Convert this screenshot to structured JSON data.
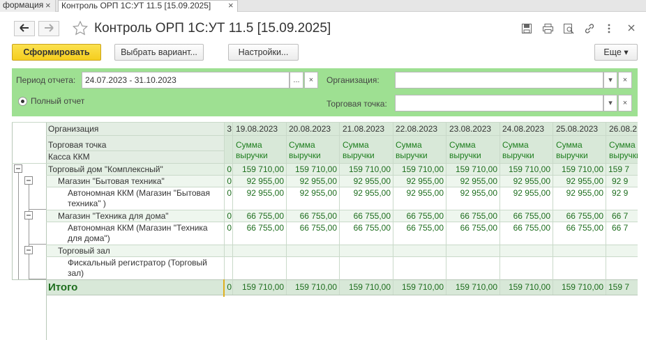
{
  "tabs": {
    "tab1_label": "формация",
    "tab2_label": "Контроль ОРП 1С:УТ 11.5 [15.09.2025]",
    "close": "×"
  },
  "window": {
    "title": "Контроль ОРП 1С:УТ 11.5 [15.09.2025]",
    "back": "🡐",
    "forward": "🡒"
  },
  "commands": {
    "generate": "Сформировать",
    "choose_variant": "Выбрать вариант...",
    "settings": "Настройки...",
    "more": "Еще ▾"
  },
  "settings": {
    "period_label": "Период отчета:",
    "period_value": "24.07.2023 - 31.10.2023",
    "organization_label": "Организация:",
    "organization_value": "",
    "trade_point_label": "Торговая точка:",
    "trade_point_value": "",
    "full_report_label": "Полный отчет",
    "ellipsis": "...",
    "clear": "×",
    "dropdown": "▾"
  },
  "report": {
    "header_col1": [
      "Организация",
      "Торговая точка",
      "Касса ККМ"
    ],
    "dates": [
      "19.08.2023",
      "20.08.2023",
      "21.08.2023",
      "22.08.2023",
      "23.08.2023",
      "24.08.2023",
      "25.08.2023",
      "26.08.2"
    ],
    "measure_label_1": "Сумма",
    "measure_label_2": "выручки",
    "partial_col_header": "3",
    "partial_col_value": "0",
    "rows": [
      {
        "label": "Торговый дом \"Комплексный\"",
        "value": "159 710,00",
        "partial": "159 7"
      },
      {
        "label": "Магазин \"Бытовая техника\"",
        "value": "92 955,00",
        "partial": "92 9"
      },
      {
        "label1": "Автономная ККМ (Магазин \"Бытовая",
        "label2": "техника\" )",
        "value": "92 955,00",
        "partial": "92 9"
      },
      {
        "label": "Магазин \"Техника для дома\"",
        "value": "66 755,00",
        "partial": "66 7"
      },
      {
        "label1": "Автономная ККМ (Магазин \"Техника",
        "label2": "для дома\")",
        "value": "66 755,00",
        "partial": "66 7"
      },
      {
        "label": "Торговый зал"
      },
      {
        "label1": "Фискальный регистратор (Торговый",
        "label2": "зал)"
      }
    ],
    "total_label": "Итого",
    "total_value": "159 710,00",
    "total_partial": "159 7"
  }
}
